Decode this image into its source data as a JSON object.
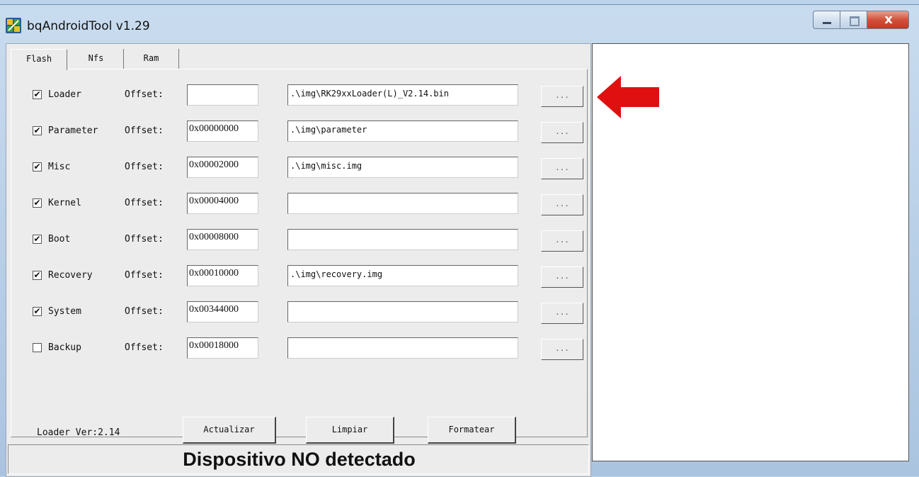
{
  "window": {
    "title": "bqAndroidTool v1.29",
    "close_glyph": "x",
    "app_icon": "bq-app-icon"
  },
  "tabs": [
    {
      "label": "Flash",
      "active": true
    },
    {
      "label": "Nfs",
      "active": false
    },
    {
      "label": "Ram",
      "active": false
    }
  ],
  "offset_label": "Offset:",
  "browse_label": "...",
  "rows": [
    {
      "name": "Loader",
      "checked": true,
      "offset": "",
      "path": ".\\img\\RK29xxLoader(L)_V2.14.bin"
    },
    {
      "name": "Parameter",
      "checked": true,
      "offset": "0x00000000",
      "path": ".\\img\\parameter"
    },
    {
      "name": "Misc",
      "checked": true,
      "offset": "0x00002000",
      "path": ".\\img\\misc.img"
    },
    {
      "name": "Kernel",
      "checked": true,
      "offset": "0x00004000",
      "path": ""
    },
    {
      "name": "Boot",
      "checked": true,
      "offset": "0x00008000",
      "path": ""
    },
    {
      "name": "Recovery",
      "checked": true,
      "offset": "0x00010000",
      "path": ".\\img\\recovery.img"
    },
    {
      "name": "System",
      "checked": true,
      "offset": "0x00344000",
      "path": ""
    },
    {
      "name": "Backup",
      "checked": false,
      "offset": "0x00018000",
      "path": ""
    }
  ],
  "check_glyph": "✔",
  "loader_version": "Loader Ver:2.14",
  "buttons": {
    "update": "Actualizar",
    "clear": "Limpiar",
    "format": "Formatear"
  },
  "status": "Dispositivo NO detectado",
  "colors": {
    "annotation_arrow": "#e01010"
  }
}
